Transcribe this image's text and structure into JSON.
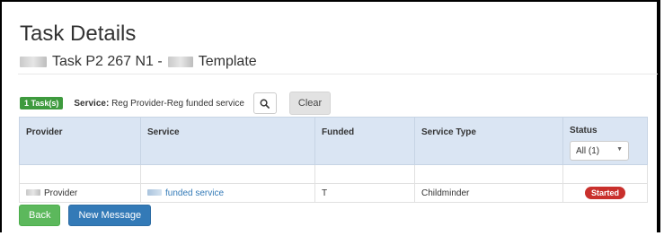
{
  "header": {
    "title": "Task Details",
    "subtitle_mid": "Task P2 267 N1 -",
    "subtitle_end": "Template"
  },
  "toolbar": {
    "count_badge": "1 Task(s)",
    "service_label": "Service:",
    "service_value": "Reg Provider-Reg funded service",
    "search_icon": "search-icon",
    "clear_label": "Clear"
  },
  "table": {
    "columns": [
      "Provider",
      "Service",
      "Funded",
      "Service Type",
      "Status"
    ],
    "status_filter": "All (1)",
    "rows": [
      {
        "provider": "Provider",
        "service": "funded service",
        "funded": "T",
        "service_type": "Childminder",
        "status": "Started"
      }
    ]
  },
  "actions": {
    "back_label": "Back",
    "new_message_label": "New Message"
  },
  "colors": {
    "count_badge": "#3e9a3e",
    "status_started": "#c9302c",
    "back_button": "#5cb85c",
    "primary_button": "#337ab7",
    "table_header": "#dae5f3"
  }
}
